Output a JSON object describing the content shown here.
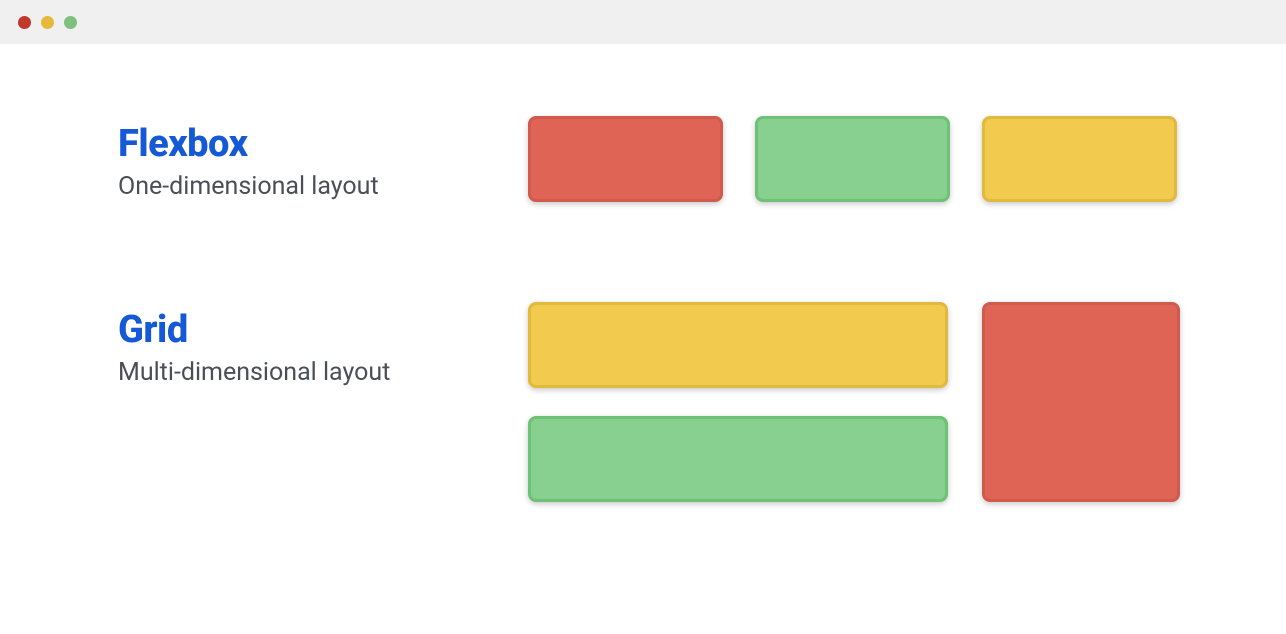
{
  "sections": {
    "flexbox": {
      "title": "Flexbox",
      "subtitle": "One-dimensional layout"
    },
    "grid": {
      "title": "Grid",
      "subtitle": "Multi-dimensional layout"
    }
  },
  "colors": {
    "red": "#e06455",
    "green": "#87d08f",
    "yellow": "#f2cb4e",
    "title_blue": "#1559d6",
    "subtitle_gray": "#4a4f57"
  }
}
